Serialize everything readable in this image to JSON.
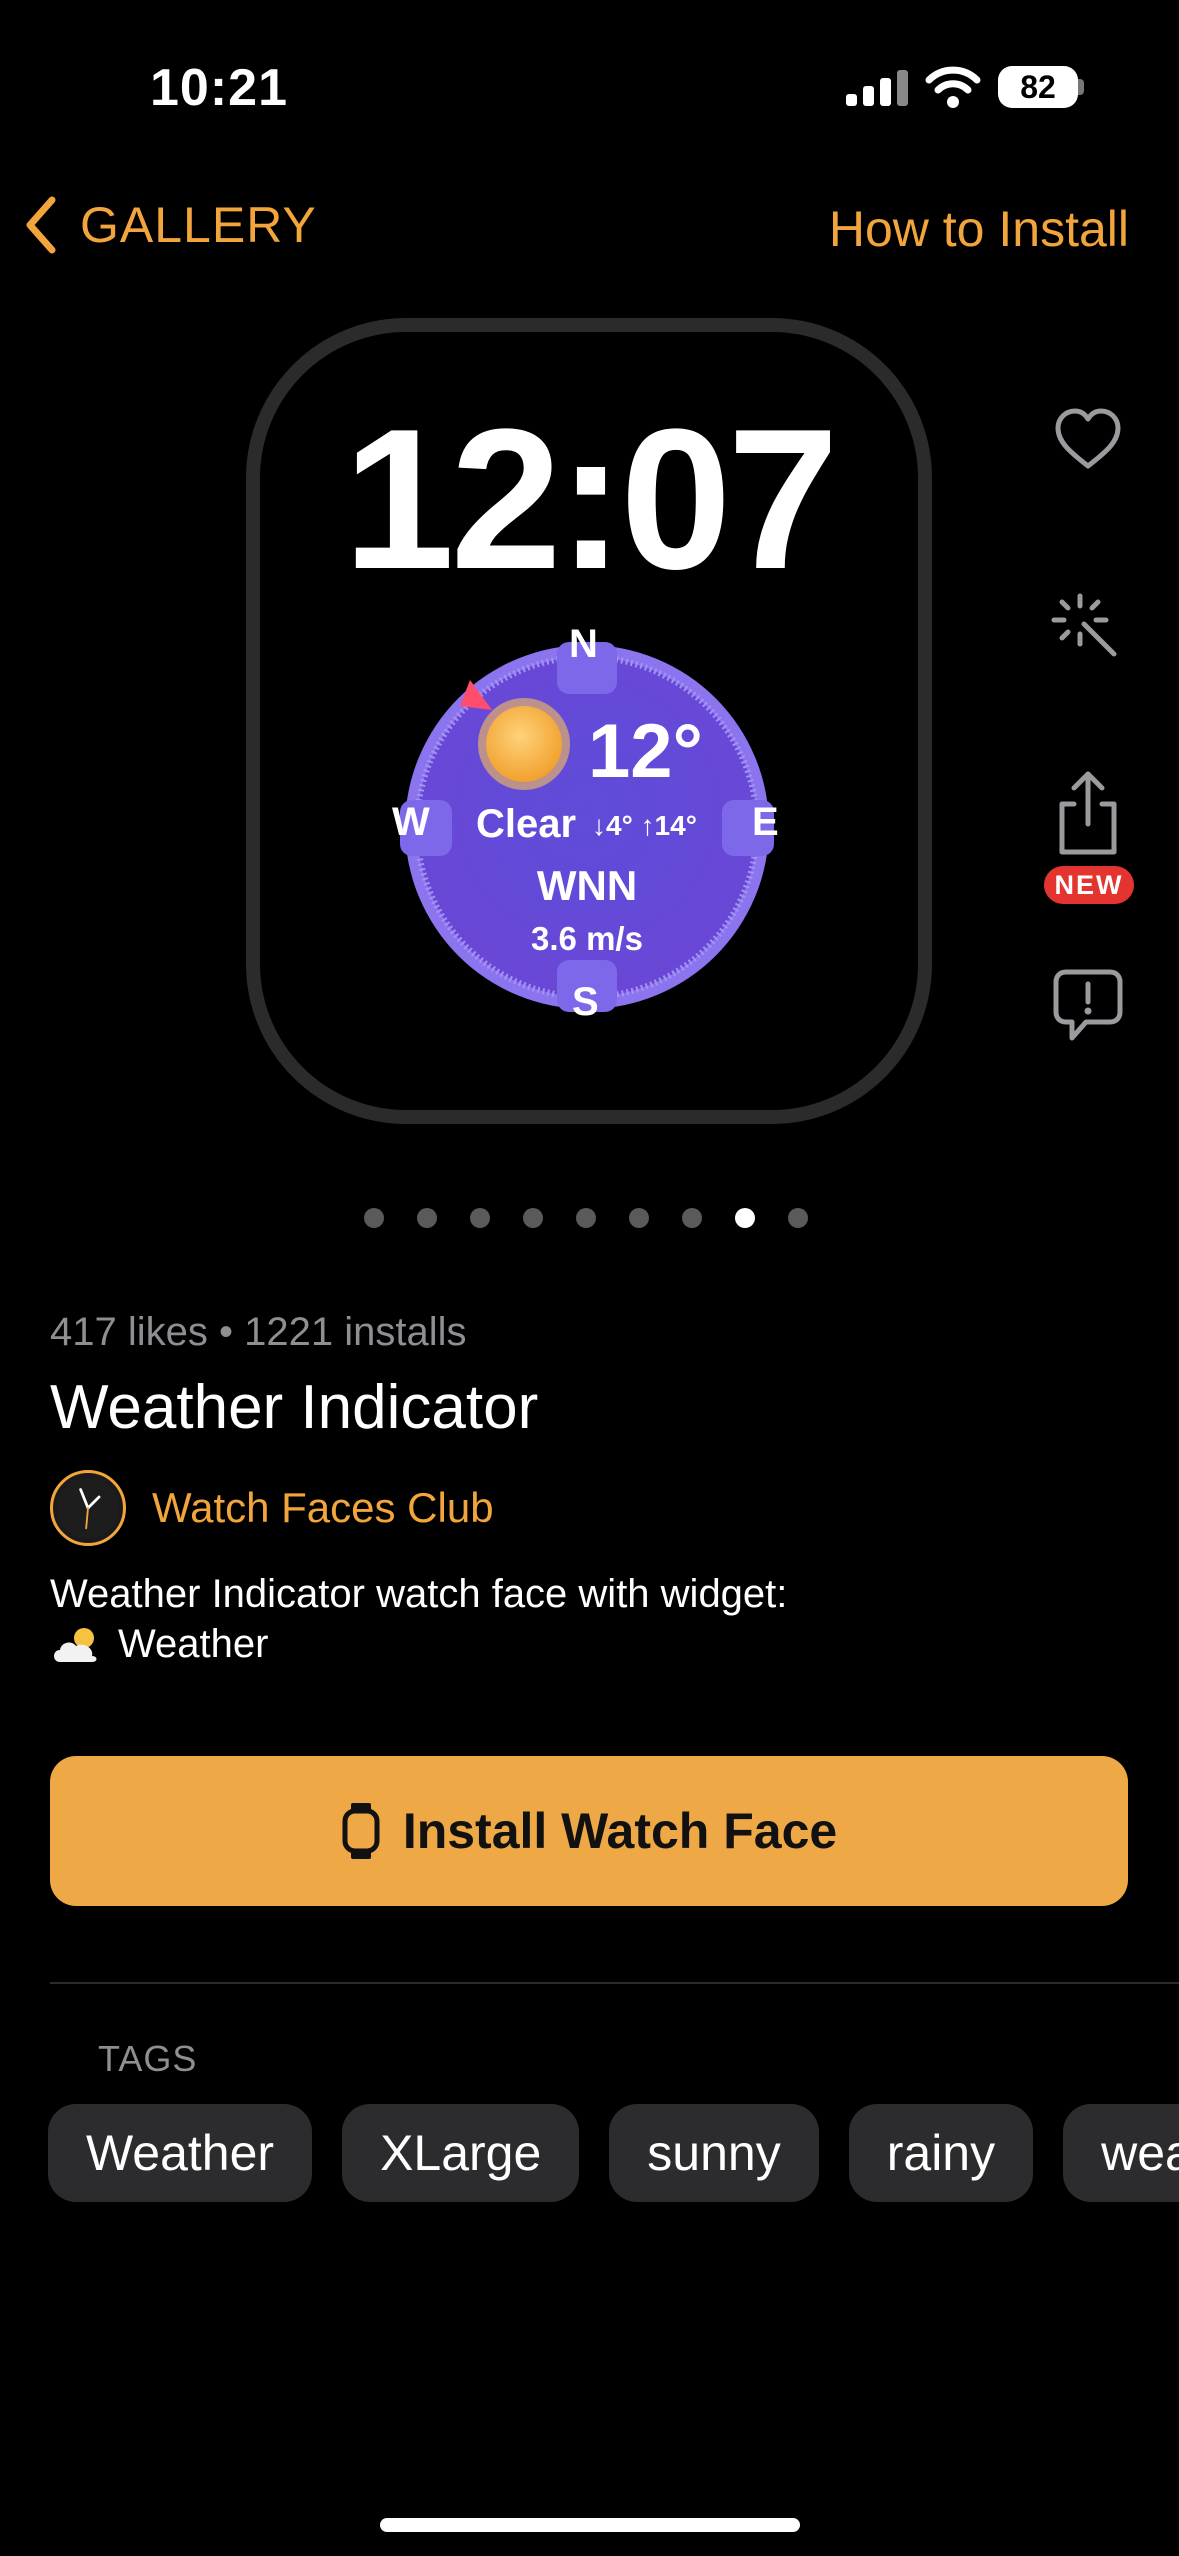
{
  "status_bar": {
    "time": "10:21",
    "battery": "82"
  },
  "nav": {
    "back_label": "GALLERY",
    "how_to_install": "How to Install"
  },
  "watch_face": {
    "time": "12:07",
    "temperature": "12°",
    "condition": "Clear",
    "range": "↓4° ↑14°",
    "wind_direction": "WNN",
    "wind_speed": "3.6 m/s",
    "compass": {
      "n": "N",
      "s": "S",
      "e": "E",
      "w": "W"
    }
  },
  "side_actions": {
    "new_badge": "NEW"
  },
  "pager": {
    "count": 9,
    "active_index": 7
  },
  "info": {
    "stats": "417 likes • 1221 installs",
    "title": "Weather Indicator",
    "author": "Watch Faces Club",
    "description_line1": "Weather Indicator watch face with widget:",
    "description_line2": "Weather"
  },
  "install_button": {
    "label": "Install Watch Face"
  },
  "tags": {
    "heading": "TAGS",
    "items": [
      "Weather",
      "XLarge",
      "sunny",
      "rainy",
      "wea"
    ]
  },
  "colors": {
    "accent": "#f2a53c",
    "button": "#eea846",
    "compass": "#6a4fd8",
    "badge": "#e3342f"
  }
}
